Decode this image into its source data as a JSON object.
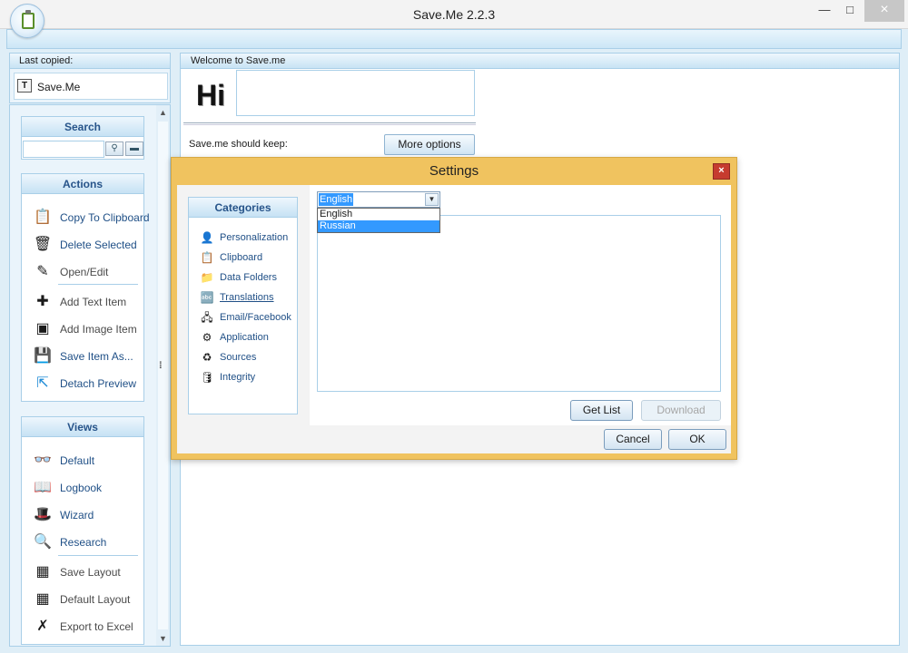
{
  "window": {
    "title": "Save.Me 2.2.3",
    "minimize": "—",
    "maximize": "□",
    "close": "×"
  },
  "last_copied": {
    "header": "Last copied:",
    "item": "Save.Me"
  },
  "sidebar": {
    "search": {
      "title": "Search",
      "go_icon": "binoculars-icon",
      "clear_icon": "eraser-icon"
    },
    "actions": {
      "title": "Actions",
      "items": [
        {
          "label": "Copy To Clipboard",
          "icon": "clipboard-copy-icon"
        },
        {
          "label": "Delete Selected",
          "icon": "clipboard-delete-icon"
        },
        {
          "label": "Open/Edit",
          "icon": "pencil-icon"
        },
        {
          "label": "Add Text Item",
          "icon": "add-text-icon"
        },
        {
          "label": "Add Image Item",
          "icon": "add-image-icon"
        },
        {
          "label": "Save Item As...",
          "icon": "save-as-icon"
        },
        {
          "label": "Detach Preview",
          "icon": "detach-icon"
        }
      ]
    },
    "views": {
      "title": "Views",
      "items": [
        {
          "label": "Default",
          "icon": "glasses-icon"
        },
        {
          "label": "Logbook",
          "icon": "logbook-icon"
        },
        {
          "label": "Wizard",
          "icon": "wizard-hat-icon"
        },
        {
          "label": "Research",
          "icon": "research-icon"
        },
        {
          "label": "Save Layout",
          "icon": "save-layout-icon"
        },
        {
          "label": "Default Layout",
          "icon": "default-layout-icon"
        },
        {
          "label": "Export to Excel",
          "icon": "excel-icon"
        }
      ]
    }
  },
  "main": {
    "header": "Welcome to Save.me",
    "hi": "Hi",
    "keep_label": "Save.me should keep:",
    "more_options": "More options"
  },
  "settings": {
    "title": "Settings",
    "close": "×",
    "categories_title": "Categories",
    "categories": [
      {
        "label": "Personalization",
        "icon": "person-icon"
      },
      {
        "label": "Clipboard",
        "icon": "clipboard-icon"
      },
      {
        "label": "Data Folders",
        "icon": "folder-icon"
      },
      {
        "label": "Translations",
        "icon": "translations-icon"
      },
      {
        "label": "Email/Facebook",
        "icon": "network-icon"
      },
      {
        "label": "Application",
        "icon": "application-icon"
      },
      {
        "label": "Sources",
        "icon": "sources-icon"
      },
      {
        "label": "Integrity",
        "icon": "database-icon"
      }
    ],
    "language": {
      "selected": "English",
      "options": [
        "English",
        "Russian"
      ],
      "highlighted": "Russian"
    },
    "get_list": "Get List",
    "download": "Download",
    "cancel": "Cancel",
    "ok": "OK"
  }
}
